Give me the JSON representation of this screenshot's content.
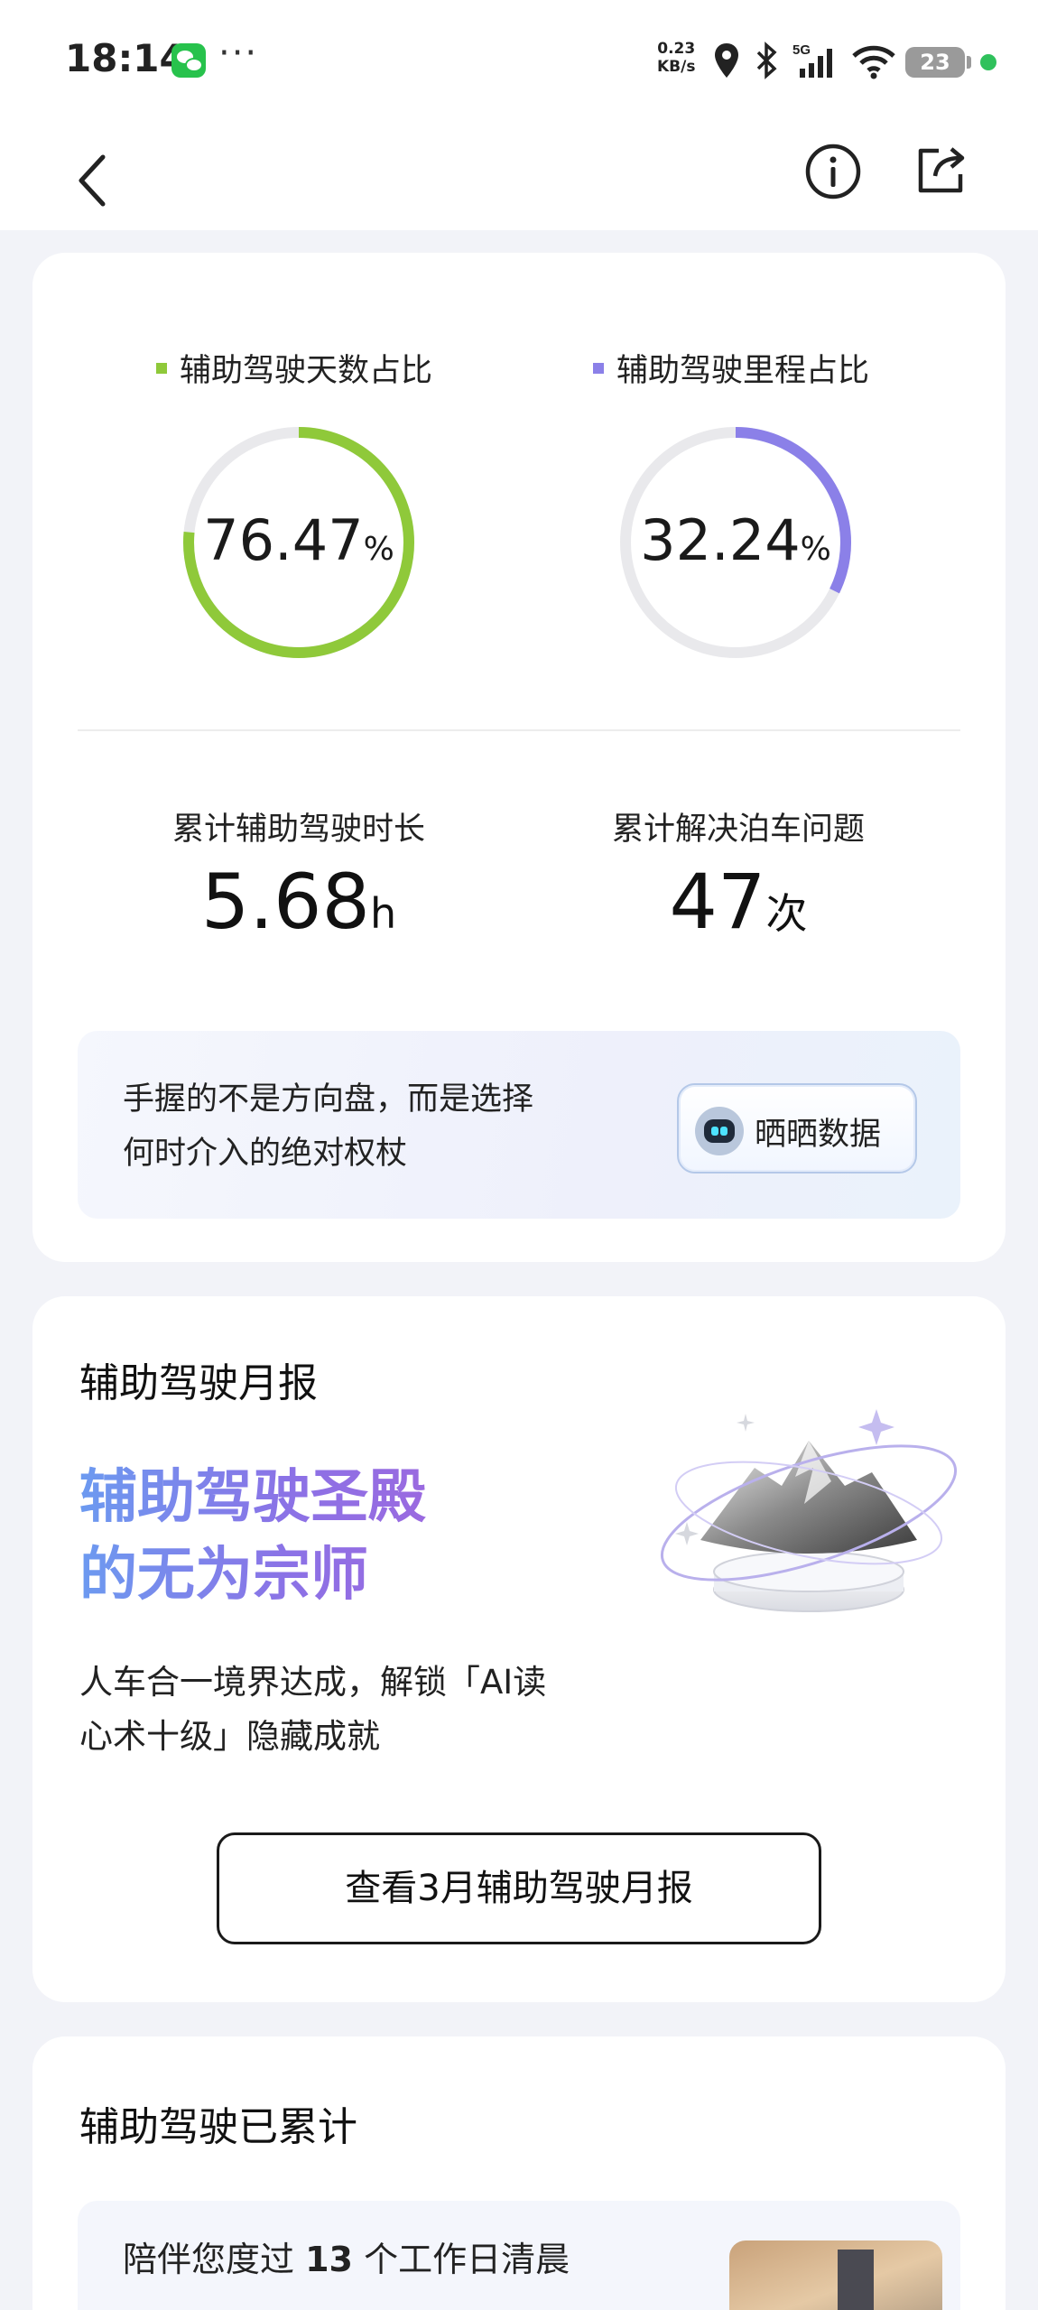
{
  "status_bar": {
    "time": "18:14",
    "net_speed_value": "0.23",
    "net_speed_unit": "KB/s",
    "battery": "23"
  },
  "summary": {
    "days_ratio": {
      "label": "辅助驾驶天数占比",
      "value": "76.47",
      "unit": "%",
      "fraction": 0.7647,
      "color": "#8fc93a"
    },
    "mileage_ratio": {
      "label": "辅助驾驶里程占比",
      "value": "32.24",
      "unit": "%",
      "fraction": 0.3224,
      "color": "#8b80e8"
    },
    "duration": {
      "label": "累计辅助驾驶时长",
      "value": "5.68",
      "unit": "h"
    },
    "parking": {
      "label": "累计解决泊车问题",
      "value": "47",
      "unit": "次"
    },
    "quote_line1": "手握的不是方向盘，而是选择",
    "quote_line2": "何时介入的绝对权杖",
    "share_button": "晒晒数据"
  },
  "monthly_report": {
    "heading": "辅助驾驶月报",
    "title_line1": "辅助驾驶圣殿",
    "title_line2": "的无为宗师",
    "desc_line1": "人车合一境界达成，解锁「AI读",
    "desc_line2": "心术十级」隐藏成就",
    "button": "查看3月辅助驾驶月报"
  },
  "cumulative": {
    "heading": "辅助驾驶已累计",
    "text_prefix": "陪伴您度过 ",
    "count": "13",
    "text_suffix": " 个工作日清晨"
  }
}
